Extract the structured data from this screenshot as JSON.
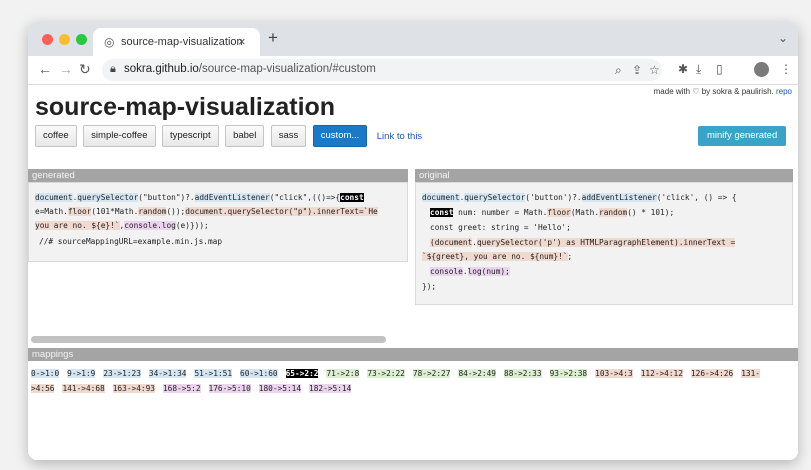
{
  "browser": {
    "tab_title": "source-map-visualization",
    "tab_close": "×",
    "new_tab": "+",
    "url_host": "sokra.github.io",
    "url_path": "/source-map-visualization/#custom"
  },
  "header": {
    "credit_prefix": "made with ♡ by sokra & paulirish.",
    "credit_link": "repo",
    "title": "source-map-visualization"
  },
  "toolbar": {
    "buttons": [
      "coffee",
      "simple-coffee",
      "typescript",
      "babel",
      "sass",
      "custom..."
    ],
    "link_label": "Link to this",
    "minify_label": "minify generated"
  },
  "generated": {
    "header": "generated",
    "lines": [
      [
        "document",
        ".",
        "querySelector",
        "(\"button\")?.",
        "addEventListener",
        "(\"click\",(()=>{",
        "const"
      ],
      [
        "e=Math.",
        "floor",
        "(101*Math.",
        "random",
        "());",
        "document",
        ".",
        "querySelector",
        "(\"p\").",
        "innerText=`He"
      ],
      [
        "you are no. ${e}!`",
        ",",
        "console",
        ".",
        "log",
        "(e)}));"
      ],
      [
        "//# sourceMappingURL=example.min.js.map"
      ]
    ]
  },
  "original": {
    "header": "original",
    "lines": [
      [
        "document",
        ".",
        "querySelector",
        "('button')?.",
        "addEventListener",
        "('click', () => {"
      ],
      [
        "const",
        " num: number = Math.",
        "floor",
        "(Math.",
        "random",
        "() * 101);"
      ],
      [
        "const greet: string = 'Hello';"
      ],
      [
        "(",
        "document",
        ".",
        "querySelector",
        "('p') as HTMLParagraphElement).",
        "innerText",
        " ="
      ],
      [
        "`${greet}, you are no. ${num}!`",
        ";"
      ],
      [
        "console",
        ".",
        "log",
        "(num);"
      ],
      [
        "});"
      ]
    ]
  },
  "mappings": {
    "header": "mappings",
    "items": [
      "0->1:0",
      "9->1:9",
      "23->1:23",
      "34->1:34",
      "51->1:51",
      "60->1:60",
      "65->2:2",
      "71->2:8",
      "73->2:22",
      "78->2:27",
      "84->2:49",
      "88->2:33",
      "93->2:38",
      "103->4:3",
      "112->4:12",
      "126->4:26",
      "131->4:56",
      "141->4:68",
      "163->4:93",
      "168->5:2",
      "176->5:10",
      "180->5:14",
      "182->5:14"
    ]
  },
  "colors": {
    "accent": "#1a7ac8",
    "minify": "#3aa3c8",
    "hl_blue": "#d5e6f3",
    "hl_red": "#f0d9cf",
    "hl_purple": "#ebd5ee",
    "hl_green": "#dcefd2"
  }
}
